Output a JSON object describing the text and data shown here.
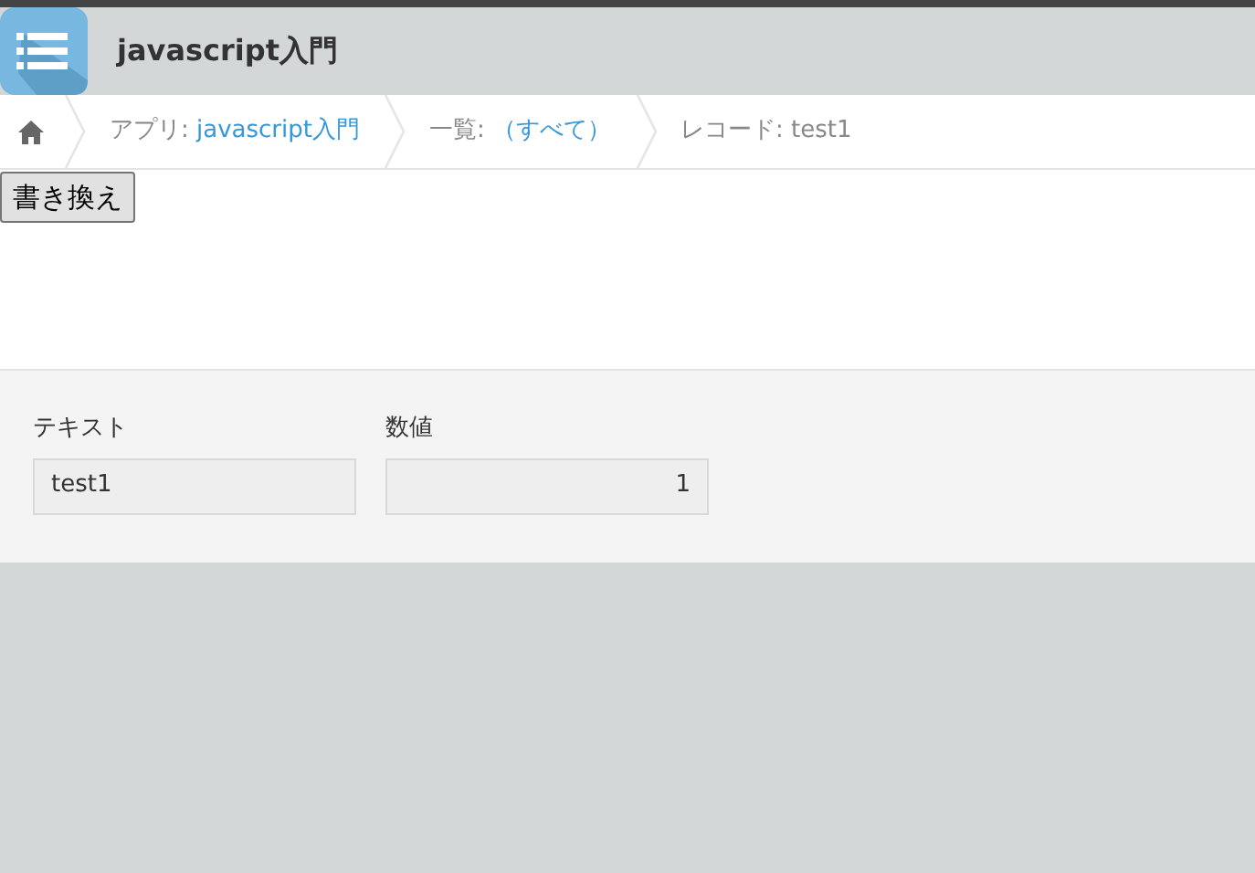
{
  "header": {
    "title": "javascript入門"
  },
  "breadcrumbs": [
    {
      "kind": "home"
    },
    {
      "kind": "link",
      "prefix": "アプリ: ",
      "link": "javascript入門"
    },
    {
      "kind": "link",
      "prefix": "一覧: ",
      "link": "（すべて）"
    },
    {
      "kind": "text",
      "prefix": "レコード: test1"
    }
  ],
  "button": "書き換え",
  "fields": [
    {
      "kind": "text",
      "label": "テキスト",
      "value": "test1"
    },
    {
      "kind": "number",
      "label": "数値",
      "value": "1"
    }
  ]
}
